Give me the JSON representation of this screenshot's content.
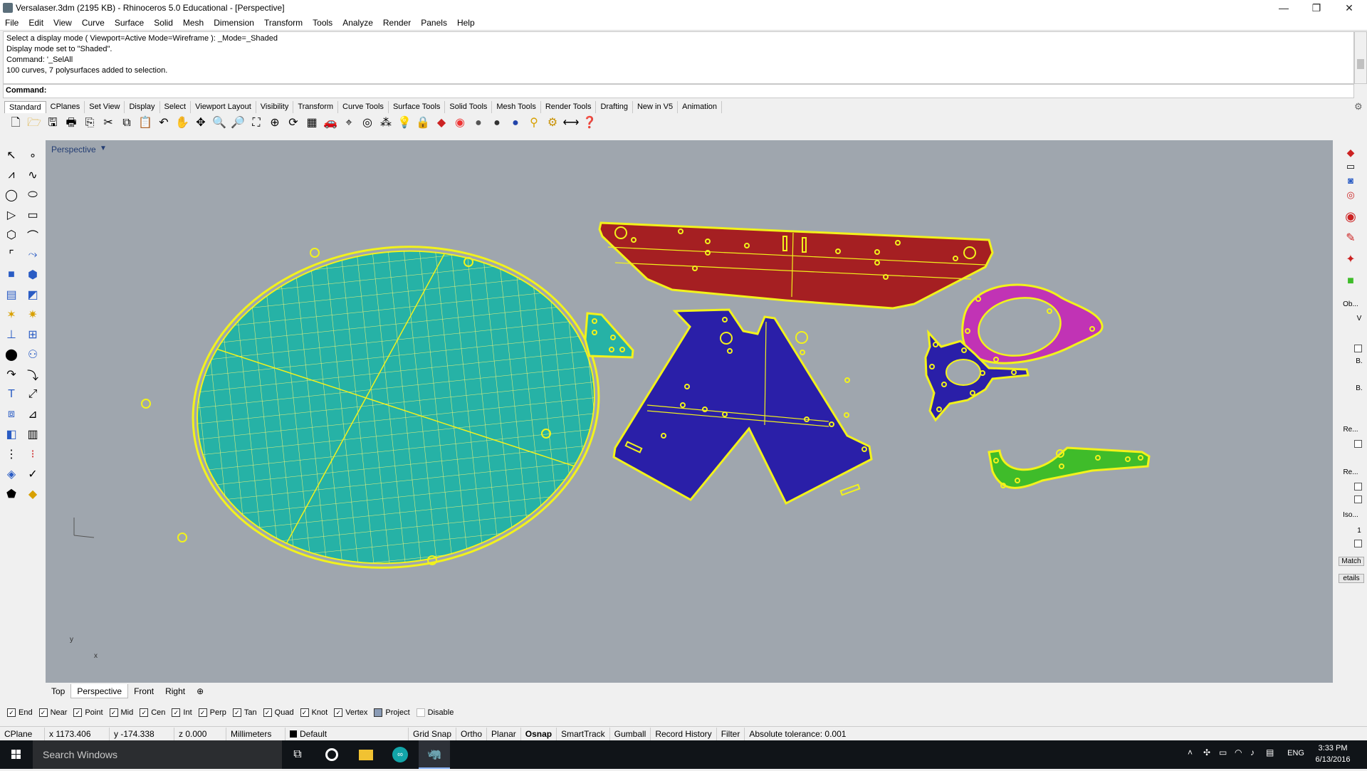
{
  "window": {
    "title": "Versalaser.3dm (2195 KB) - Rhinoceros 5.0 Educational - [Perspective]",
    "controls": [
      "—",
      "❐",
      "✕"
    ]
  },
  "menu": [
    "File",
    "Edit",
    "View",
    "Curve",
    "Surface",
    "Solid",
    "Mesh",
    "Dimension",
    "Transform",
    "Tools",
    "Analyze",
    "Render",
    "Panels",
    "Help"
  ],
  "command_history": [
    "Select a display mode ( Viewport=Active  Mode=Wireframe ): _Mode=_Shaded",
    "Display mode set to \"Shaded\".",
    "Command: '_SelAll",
    "100 curves, 7 polysurfaces added to selection."
  ],
  "command_prompt": {
    "label": "Command:",
    "value": ""
  },
  "toolbar_tabs": [
    "Standard",
    "CPlanes",
    "Set View",
    "Display",
    "Select",
    "Viewport Layout",
    "Visibility",
    "Transform",
    "Curve Tools",
    "Surface Tools",
    "Solid Tools",
    "Mesh Tools",
    "Render Tools",
    "Drafting",
    "New in V5",
    "Animation"
  ],
  "active_toolbar_tab": "Standard",
  "viewport": {
    "label": "Perspective",
    "tabs": [
      "Top",
      "Perspective",
      "Front",
      "Right",
      "⊕"
    ],
    "active_tab": "Perspective",
    "axis": {
      "x": "x",
      "y": "y"
    }
  },
  "right_panel": {
    "labels": [
      "Ob...",
      "V",
      "B.",
      "B.",
      "Re...",
      "Re...",
      "Iso...",
      "1",
      "Match",
      "etails"
    ]
  },
  "osnaps": [
    {
      "label": "End",
      "checked": true
    },
    {
      "label": "Near",
      "checked": true
    },
    {
      "label": "Point",
      "checked": true
    },
    {
      "label": "Mid",
      "checked": true
    },
    {
      "label": "Cen",
      "checked": true
    },
    {
      "label": "Int",
      "checked": true
    },
    {
      "label": "Perp",
      "checked": true
    },
    {
      "label": "Tan",
      "checked": true
    },
    {
      "label": "Quad",
      "checked": true
    },
    {
      "label": "Knot",
      "checked": true
    },
    {
      "label": "Vertex",
      "checked": true
    },
    {
      "label": "Project",
      "checked": false
    },
    {
      "label": "Disable",
      "checked": false
    }
  ],
  "status": {
    "cplane": "CPlane",
    "x": "x 1173.406",
    "y": "y -174.338",
    "z": "z 0.000",
    "units": "Millimeters",
    "layer": "Default",
    "grid_snap": "Grid Snap",
    "ortho": "Ortho",
    "planar": "Planar",
    "osnap": "Osnap",
    "smarttrack": "SmartTrack",
    "gumball": "Gumball",
    "record_history": "Record History",
    "filter": "Filter",
    "tolerance": "Absolute tolerance: 0.001"
  },
  "taskbar": {
    "search_placeholder": "Search Windows",
    "language": "ENG",
    "time": "3:33 PM",
    "date": "6/13/2016"
  },
  "colors": {
    "viewport_bg": "#9fa6ae",
    "selection": "#f2f21c",
    "red_part": "#a51f22",
    "blue_part": "#2a1fa8",
    "teal_part": "#25b4a4",
    "magenta_part": "#c133b5",
    "green_part": "#3fbc2a"
  }
}
